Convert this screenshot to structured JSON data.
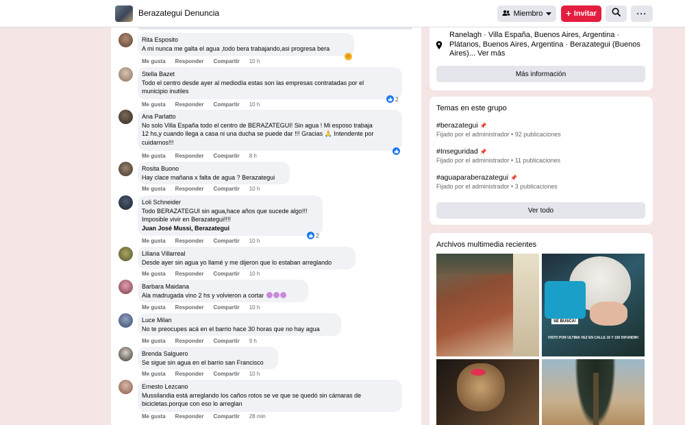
{
  "header": {
    "group_name": "Berazategui Denuncia",
    "member_label": "Miembro",
    "invite_label": "Invitar",
    "icons": [
      "group-icon",
      "chevron-down-icon",
      "plus-icon",
      "search-icon",
      "more-icon"
    ]
  },
  "colors": {
    "invite": "#e41e3f",
    "like": "#1877f2",
    "bubble": "#f0f2f5",
    "background": "#f5e5e5"
  },
  "comment_actions": {
    "like": "Me gusta",
    "reply": "Responder",
    "share": "Compartir"
  },
  "comments": [
    {
      "author": "Rita Esposito",
      "lines": [
        "A mi nunca me galta el agua ,todo bera trabajando,asi progresa bera"
      ],
      "time": "10 h",
      "reaction": "haha"
    },
    {
      "author": "Stella Bazet",
      "lines": [
        "Todo el centro desde ayer al mediodía estas son las empresas contratadas por el",
        "municipio inutiles"
      ],
      "time": "10 h",
      "reaction": "like",
      "reaction_count": "2"
    },
    {
      "author": "Ana Parlatto",
      "lines": [
        "No solo Villa España todo el centro de BERAZATEGUI! Sin agua ! Mi esposo trabaja",
        "12 hs,y cuando llega a casa ni una ducha se puede dar !!! Gracias 🙏 Intendente por",
        "cuidarnos!!!"
      ],
      "time": "8 h",
      "reaction": "like"
    },
    {
      "author": "Rosita Buono",
      "lines": [
        "Hay clace mañana x falta de agua ? Berazategui"
      ],
      "time": "10 h"
    },
    {
      "author": "Loli Schneider",
      "lines": [
        "Todo BERAZATEGUI sin agua,hace años que sucede algo!!!",
        "Imposible vivir en Berazategui!!!!"
      ],
      "tag": "Juan José Mussi, Berazategui",
      "time": "10 h",
      "reaction": "like",
      "reaction_count": "2"
    },
    {
      "author": "Liliana Villarreal",
      "lines": [
        "Desde ayer sin agua yo llamé y me dijeron que lo estaban arreglando"
      ],
      "time": "10 h"
    },
    {
      "author": "Barbara Maidana",
      "lines": [
        "Ala madrugada vino 2 hs y volvieron a cortar"
      ],
      "time": "10 h"
    },
    {
      "author": "Luce Milan",
      "lines": [
        "No te preocupes acá en el barrio hace 30 horas que no hay agua"
      ],
      "time": "9 h"
    },
    {
      "author": "Brenda Salguero",
      "lines": [
        "Se sigue sin agua en el barrio san Francisco"
      ],
      "time": "10 h"
    },
    {
      "author": "Ernesto Lezcano",
      "lines": [
        "Mussilandia está arreglando los caños rotos se ve que se quedó sin cámaras de",
        "bicicletas.porque con eso lo arreglan"
      ],
      "time": "28 min"
    }
  ],
  "sidebar": {
    "about": {
      "location": "Ranelagh · Villa España, Buenos Aires, Argentina · Plátanos, Buenos Aires, Argentina · Berazategui (Buenos Aires)...",
      "see_more": "Ver más",
      "more_info_button": "Más información"
    },
    "topics": {
      "title": "Temas en este grupo",
      "items": [
        {
          "name": "#berazategui",
          "meta": "Fijado por el administrador • 92 publicaciones"
        },
        {
          "name": "#Inseguridad",
          "meta": "Fijado por el administrador • 11 publicaciones"
        },
        {
          "name": "#aguaparaberazategui",
          "meta": "Fijado por el administrador • 3 publicaciones"
        }
      ],
      "see_all_button": "Ver todo"
    },
    "media": {
      "title": "Archivos multimedia recientes",
      "overlay_se_busca": "SE BUSCA!",
      "overlay_caption": "VISTO POR ULTIMA VEZ EN CALLE 16 Y 150 DIFUNDIR!"
    }
  }
}
